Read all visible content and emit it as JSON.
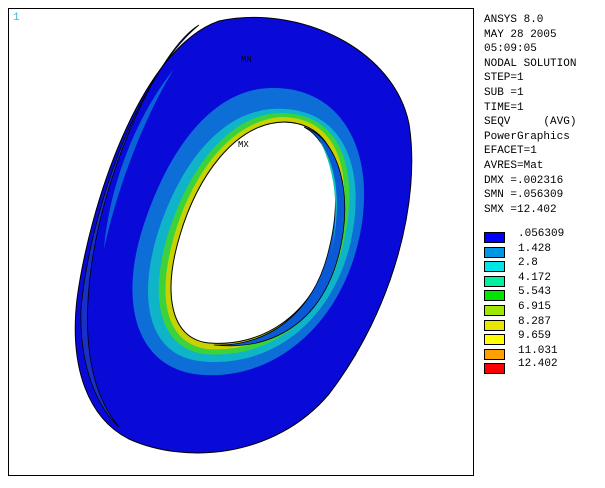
{
  "window": {
    "number": "1"
  },
  "model": {
    "min_label": "MN",
    "max_label": "MX"
  },
  "info": {
    "program": "ANSYS 8.0",
    "date": "MAY 28 2005",
    "time": "05:09:05",
    "solution": "NODAL SOLUTION",
    "step": "STEP=1",
    "sub": "SUB =1",
    "time_value": "TIME=1",
    "result": "SEQV     (AVG)",
    "graphics": "PowerGraphics",
    "efacet": "EFACET=1",
    "avres": "AVRES=Mat",
    "dmx": "DMX =.002316",
    "smn": "SMN =.056309",
    "smx": "SMX =12.402"
  },
  "legend": {
    "levels": [
      {
        "value": ".056309",
        "color": "#0000ff"
      },
      {
        "value": "1.428",
        "color": "#0096e6"
      },
      {
        "value": "2.8",
        "color": "#00e6e6"
      },
      {
        "value": "4.172",
        "color": "#00f0a0"
      },
      {
        "value": "5.543",
        "color": "#00e600"
      },
      {
        "value": "6.915",
        "color": "#a0e600"
      },
      {
        "value": "8.287",
        "color": "#e6e600"
      },
      {
        "value": "9.659",
        "color": "#ffff00"
      },
      {
        "value": "11.031",
        "color": "#ffa000"
      }
    ],
    "last_color": "#ff0000",
    "last_value": "12.402"
  }
}
